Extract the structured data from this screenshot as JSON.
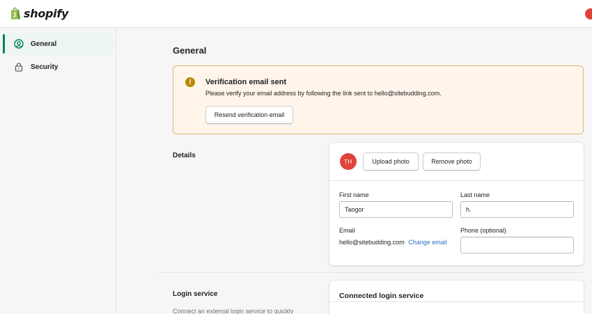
{
  "brand": {
    "name": "shopify",
    "accent": "#008060",
    "logo_bag_color": "#95bf47"
  },
  "sidebar": {
    "items": [
      {
        "label": "General",
        "icon": "user-circle-icon",
        "active": true
      },
      {
        "label": "Security",
        "icon": "lock-icon",
        "active": false
      }
    ]
  },
  "main": {
    "title": "General",
    "banner": {
      "icon": "warning-icon",
      "icon_glyph": "!",
      "title": "Verification email sent",
      "text": "Please verify your email address by following the link sent to hello@sitebudding.com.",
      "button_label": "Resend verification email",
      "bg_color": "#fff5ea",
      "border_color": "#e1b878"
    },
    "details": {
      "section_title": "Details",
      "avatar_initials": "TH",
      "avatar_color": "#e0433a",
      "upload_label": "Upload photo",
      "remove_label": "Remove photo",
      "first_name_label": "First name",
      "first_name_value": "Taogor",
      "last_name_label": "Last name",
      "last_name_value": "h.",
      "email_label": "Email",
      "email_value": "hello@sitebudding.com",
      "change_email_label": "Change email",
      "phone_label": "Phone (optional)",
      "phone_value": ""
    },
    "login": {
      "section_title": "Login service",
      "description": "Connect an external login service to quickly",
      "card_title": "Connected login service"
    }
  }
}
